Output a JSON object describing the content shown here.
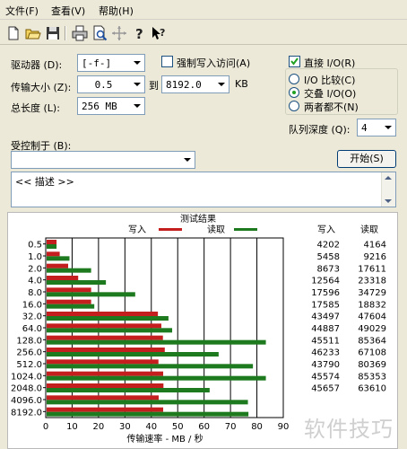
{
  "menu": {
    "items": [
      "文件(F)",
      "查看(V)",
      "帮助(H)"
    ]
  },
  "toolbar": {
    "icons": [
      "new-file-icon",
      "open-folder-icon",
      "save-icon",
      "print-icon",
      "print-preview-icon",
      "move-icon",
      "help-icon",
      "context-help-icon"
    ]
  },
  "settings": {
    "drive_label": "驱动器 (D):",
    "drive_value": "[-f-]",
    "force_write_label": "强制写入访问(A)",
    "force_write_checked": false,
    "transfer_label": "传输大小 (Z):",
    "transfer_from": "0.5",
    "to_label": "到",
    "transfer_to": "8192.0",
    "kb_label": "KB",
    "total_label": "总长度 (L):",
    "total_value": "256 MB",
    "direct_io_label": "直接 I/O(R)",
    "direct_io_checked": true,
    "radio_compare": "I/O 比较(C)",
    "radio_overlap": "交叠 I/O(O)",
    "radio_neither": "两者都不(N)",
    "selected_radio": "overlap",
    "queue_label": "队列深度 (Q):",
    "queue_value": "4",
    "controlled_by_label": "受控制于 (B):",
    "controlled_by_value": "",
    "start_button": "开始(S)",
    "description": "<< 描述 >>"
  },
  "results": {
    "title": "测试结果",
    "write_legend": "写入",
    "read_legend": "读取",
    "write_col": "写入",
    "read_col": "读取",
    "xlabel": "传输速率 - MB / 秒",
    "colors": {
      "write": "#c41e1e",
      "read": "#1e7a1e"
    }
  },
  "chart_data": {
    "type": "bar",
    "orientation": "horizontal",
    "title": "测试结果",
    "categories": [
      "0.5",
      "1.0",
      "2.0",
      "4.0",
      "8.0",
      "16.0",
      "32.0",
      "64.0",
      "128.0",
      "256.0",
      "512.0",
      "1024.0",
      "2048.0",
      "4096.0",
      "8192.0"
    ],
    "x_ticks": [
      "0",
      "10",
      "20",
      "30",
      "40",
      "50",
      "60",
      "70",
      "80",
      "90"
    ],
    "xlim": [
      0,
      90
    ],
    "xlabel": "传输速率 - MB / 秒",
    "series": [
      {
        "name": "写入",
        "values": [
          4.1,
          5.3,
          8.5,
          12.3,
          17.2,
          17.2,
          42.5,
          43.8,
          44.4,
          45.1,
          42.7,
          44.5,
          44.6,
          42.8,
          44.5
        ]
      },
      {
        "name": "读取",
        "values": [
          4.1,
          9.0,
          17.2,
          22.8,
          33.9,
          18.4,
          46.5,
          47.9,
          83.4,
          65.5,
          78.5,
          83.4,
          62.1,
          76.6,
          76.8
        ]
      }
    ],
    "write_kbps": [
      "4202",
      "5458",
      "8673",
      "12564",
      "17596",
      "17585",
      "43497",
      "44887",
      "45511",
      "46233",
      "43790",
      "45574",
      "45657",
      "",
      ""
    ],
    "read_kbps": [
      "4164",
      "9216",
      "17611",
      "23318",
      "34729",
      "18832",
      "47604",
      "49029",
      "85364",
      "67108",
      "80369",
      "85353",
      "63610",
      "",
      ""
    ]
  },
  "watermark": "软件技巧"
}
